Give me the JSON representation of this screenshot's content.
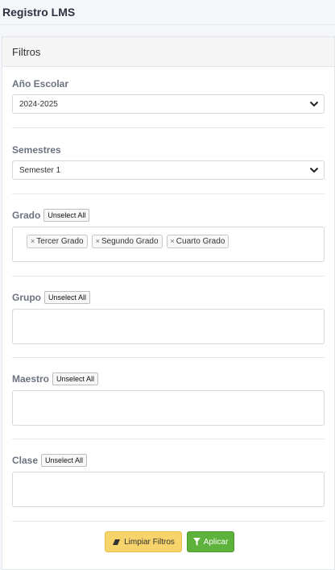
{
  "page": {
    "title": "Registro LMS"
  },
  "filters": {
    "title": "Filtros",
    "ano_escolar": {
      "label": "Año Escolar",
      "value": "2024-2025"
    },
    "semestres": {
      "label": "Semestres",
      "value": "Semester 1"
    },
    "grado": {
      "label": "Grado",
      "unselect_label": "Unselect All",
      "chips": [
        "Tercer Grado",
        "Segundo Grado",
        "Cuarto Grado"
      ]
    },
    "grupo": {
      "label": "Grupo",
      "unselect_label": "Unselect All"
    },
    "maestro": {
      "label": "Maestro",
      "unselect_label": "Unselect All"
    },
    "clase": {
      "label": "Clase",
      "unselect_label": "Unselect All"
    }
  },
  "actions": {
    "clear_label": "Limpiar Filtros",
    "apply_label": "Aplicar"
  },
  "colors": {
    "clear_button": "#f6d36b",
    "apply_button": "#5cb23a",
    "card_header": "#f5f5f5"
  },
  "icons": {
    "clear": "eraser-icon",
    "apply": "filter-icon",
    "select": "chevron-down-icon",
    "chip_remove": "close-icon"
  }
}
